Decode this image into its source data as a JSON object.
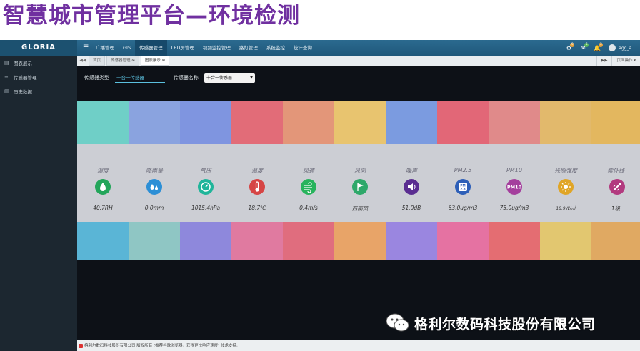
{
  "slide": {
    "title": "智慧城市管理平台—环境检测"
  },
  "app": {
    "logo": "GLORIA",
    "nav": [
      "广播管理",
      "GIS",
      "传感器管理",
      "LED屏管理",
      "视频监控管理",
      "路灯管理",
      "系统监控",
      "统计查询"
    ],
    "nav_active_index": 2,
    "badges": {
      "settings": "9",
      "mail": "5",
      "bell": "3"
    },
    "user": "agg_a..."
  },
  "sidebar": {
    "items": [
      {
        "label": "图表展示",
        "icon": "chart-icon"
      },
      {
        "label": "传感器管理",
        "icon": "list-icon"
      },
      {
        "label": "历史数据",
        "icon": "book-icon"
      }
    ]
  },
  "tabs": {
    "items": [
      "首页",
      "传感器管理",
      "图表展示"
    ],
    "active_index": 2,
    "page_ops": "页面操作"
  },
  "filter": {
    "type_label": "传感器类型",
    "type_value": "十合一传感器",
    "name_label": "传感器名称",
    "name_value": "十合一传感器"
  },
  "sensors": [
    {
      "name": "湿度",
      "value": "40.7RH",
      "icon": "water-drop-icon",
      "icon_color": "#23a55a",
      "top": "#6fcfc7",
      "bottom": "#5ab5d6"
    },
    {
      "name": "降雨量",
      "value": "0.0mm",
      "icon": "rain-drops-icon",
      "icon_color": "#2c8fd6",
      "top": "#8aa3df",
      "bottom": "#8fc6c4"
    },
    {
      "name": "气压",
      "value": "1015.4hPa",
      "icon": "gauge-icon",
      "icon_color": "#1fb59a",
      "top": "#7f95e0",
      "bottom": "#8e88dc"
    },
    {
      "name": "温度",
      "value": "18.7℃",
      "icon": "thermometer-icon",
      "icon_color": "#d64545",
      "top": "#e26c78",
      "bottom": "#e07aa0"
    },
    {
      "name": "风速",
      "value": "0.4m/s",
      "icon": "wind-icon",
      "icon_color": "#27b35c",
      "top": "#e39679",
      "bottom": "#e06d7e"
    },
    {
      "name": "风向",
      "value": "西南风",
      "icon": "flag-icon",
      "icon_color": "#2ea86a",
      "top": "#e8c46f",
      "bottom": "#e8a468"
    },
    {
      "name": "噪声",
      "value": "51.0dB",
      "icon": "speaker-icon",
      "icon_color": "#5a2d91",
      "top": "#7b9be0",
      "bottom": "#9a86e0"
    },
    {
      "name": "PM2.5",
      "value": "63.0ug/m3",
      "icon": "pm25-icon",
      "icon_color": "#2d5fb8",
      "top": "#e26777",
      "bottom": "#e572a2"
    },
    {
      "name": "PM10",
      "value": "75.0ug/m3",
      "icon": "pm10-icon",
      "icon_color": "#a43f9d",
      "top": "#e08a8a",
      "bottom": "#e46d72"
    },
    {
      "name": "光照强度",
      "value": "18.9W/㎡",
      "icon": "sun-icon",
      "icon_color": "#e0a526",
      "top": "#e2b96c",
      "bottom": "#e2c770"
    },
    {
      "name": "紫外线",
      "value": "1级",
      "icon": "uv-icon",
      "icon_color": "#b23a7f",
      "top": "#e3b75f",
      "bottom": "#e0a962"
    }
  ],
  "footer": {
    "text": "格利尔数码科技股份有限公司 版权所有 (推荐谷歌浏览器，获得更快响应速度) 技术支持:"
  },
  "watermark": {
    "text": "格利尔数码科技股份有限公司"
  }
}
